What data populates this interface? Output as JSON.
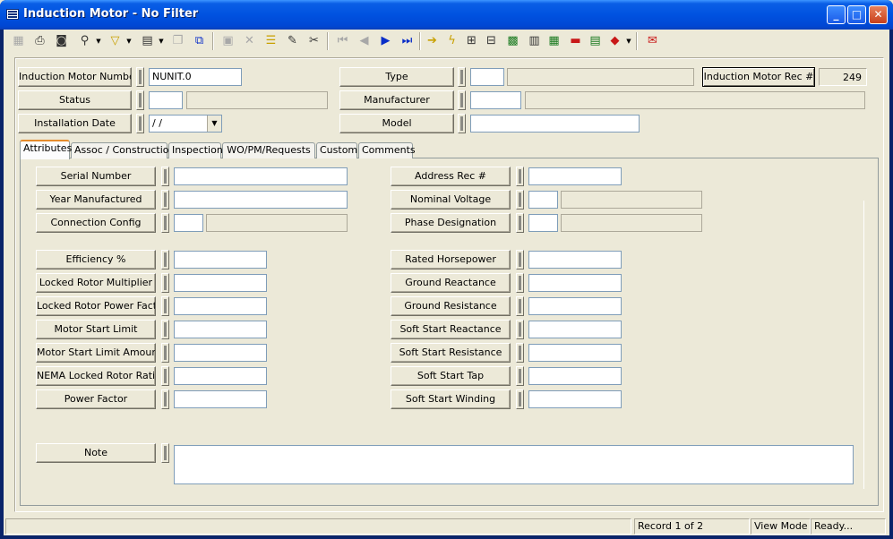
{
  "window": {
    "title": "Induction Motor - No Filter",
    "minimize": "_",
    "maximize": "□",
    "close": "✕"
  },
  "toolbar": {
    "icons": [
      "new-icon",
      "print-icon",
      "preview-icon",
      "binoculars-icon",
      "filter-icon",
      "report-icon",
      "copy-icon",
      "duplicate-icon",
      "save-icon",
      "delete-icon",
      "stack-icon",
      "pencil-icon",
      "cut-icon",
      "first-record-icon",
      "previous-record-icon",
      "next-record-icon",
      "last-record-icon",
      "arrow-right-icon",
      "lightning-icon",
      "tree-icon",
      "hierarchy-icon",
      "chart-icon",
      "calculator-icon",
      "map-icon",
      "truck-icon",
      "spreadsheet-icon",
      "book-icon",
      "mail-icon"
    ]
  },
  "header": {
    "induction_motor_number": {
      "label": "Induction Motor Number",
      "value": "NUNIT.0"
    },
    "type": {
      "label": "Type",
      "value": "",
      "desc": ""
    },
    "rec": {
      "label": "Induction Motor Rec #",
      "value": "249"
    },
    "status": {
      "label": "Status",
      "value": "",
      "desc": ""
    },
    "manufacturer": {
      "label": "Manufacturer",
      "value": "",
      "desc": ""
    },
    "installation_date": {
      "label": "Installation Date",
      "value": " /  /"
    },
    "model": {
      "label": "Model",
      "value": ""
    }
  },
  "tabs": [
    "Attributes",
    "Assoc / Construction",
    "Inspection",
    "WO/PM/Requests",
    "Custom",
    "Comments"
  ],
  "attributes": {
    "left": [
      {
        "label": "Serial Number",
        "value": ""
      },
      {
        "label": "Year Manufactured",
        "value": ""
      },
      {
        "label": "Connection Config",
        "value": "",
        "desc": ""
      },
      {
        "label": "Efficiency %",
        "value": ""
      },
      {
        "label": "Locked Rotor Multiplier",
        "value": ""
      },
      {
        "label": "Locked Rotor Power Factor",
        "value": ""
      },
      {
        "label": "Motor Start Limit",
        "value": ""
      },
      {
        "label": "Motor Start Limit Amount",
        "value": ""
      },
      {
        "label": "NEMA Locked Rotor Ratio",
        "value": ""
      },
      {
        "label": "Power Factor",
        "value": ""
      }
    ],
    "right": [
      {
        "label": "Address Rec #",
        "value": ""
      },
      {
        "label": "Nominal Voltage",
        "value": "",
        "desc": ""
      },
      {
        "label": "Phase Designation",
        "value": "",
        "desc": ""
      },
      {
        "label": "Rated Horsepower",
        "value": ""
      },
      {
        "label": "Ground Reactance",
        "value": ""
      },
      {
        "label": "Ground Resistance",
        "value": ""
      },
      {
        "label": "Soft Start Reactance",
        "value": ""
      },
      {
        "label": "Soft Start Resistance",
        "value": ""
      },
      {
        "label": "Soft Start Tap",
        "value": ""
      },
      {
        "label": "Soft Start Winding",
        "value": ""
      }
    ],
    "note": {
      "label": "Note",
      "value": ""
    }
  },
  "statusbar": {
    "blank": "",
    "record": "Record 1 of 2",
    "mode": "View Mode",
    "ready": "Ready..."
  }
}
